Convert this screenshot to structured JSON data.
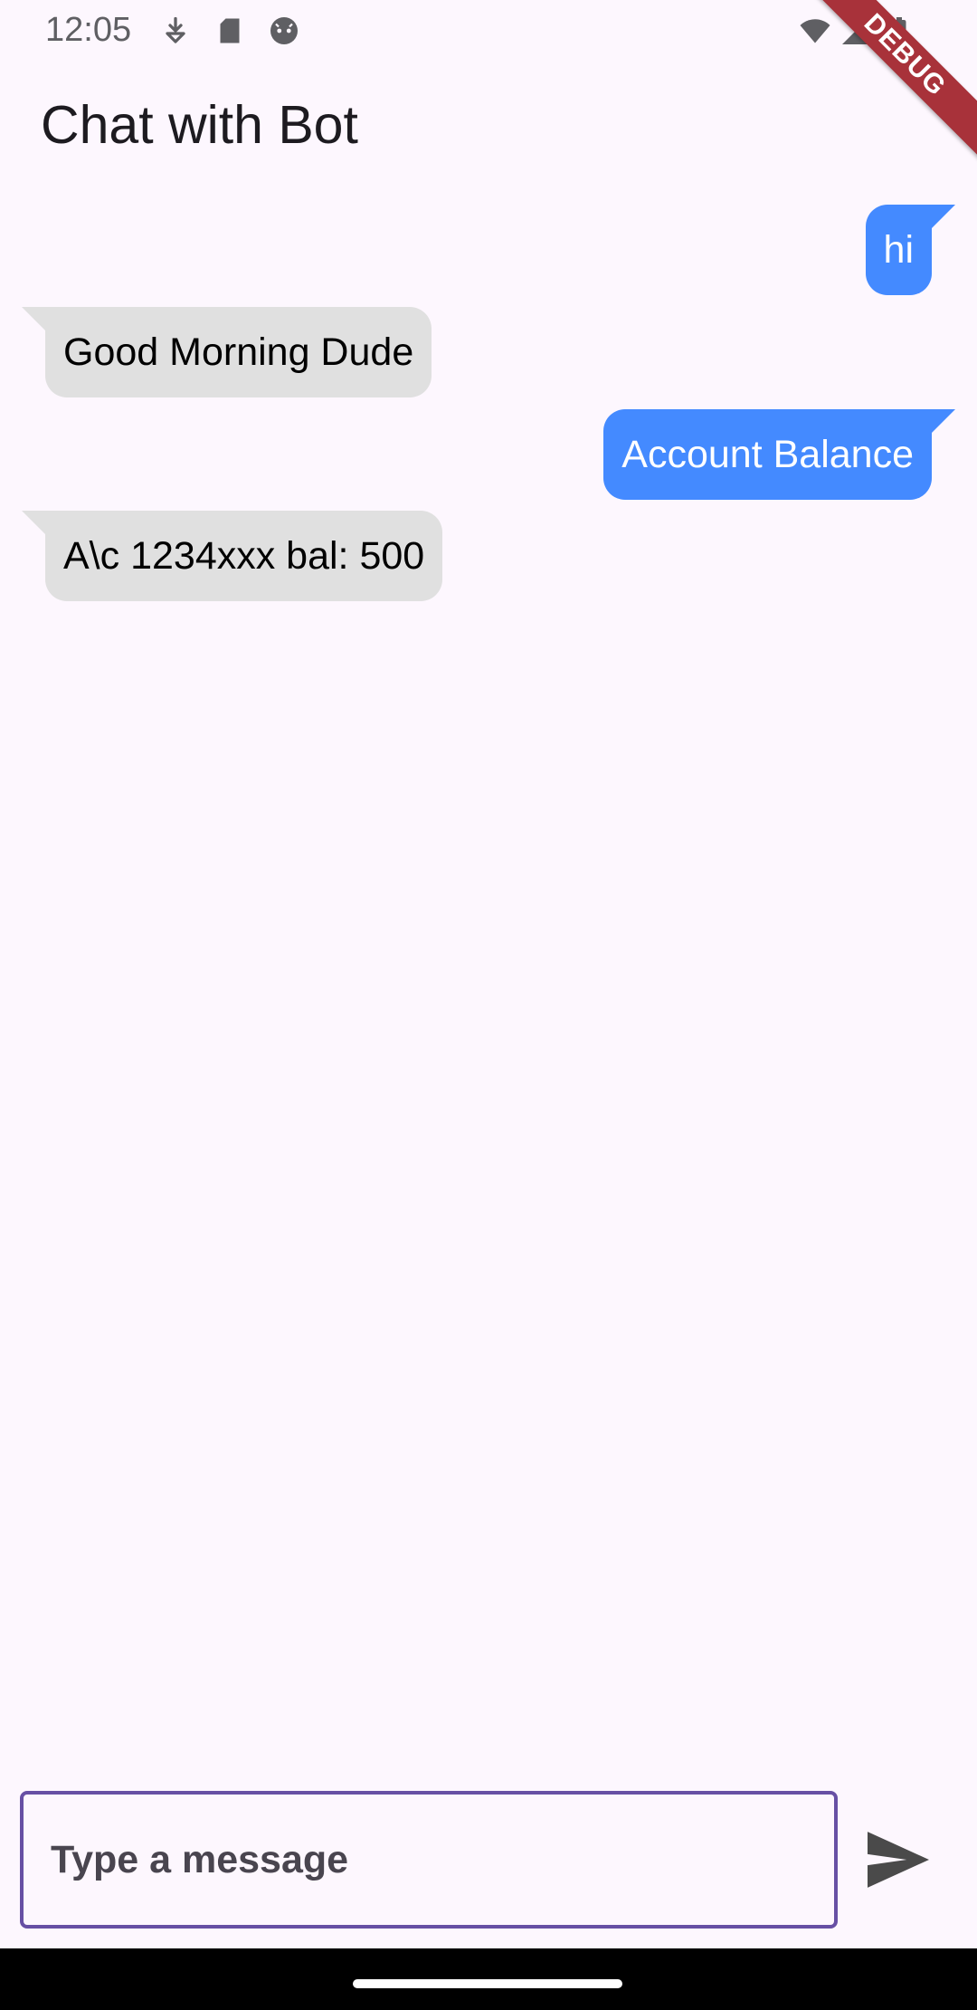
{
  "status_bar": {
    "time": "12:05",
    "left_icons": [
      "download-status-icon",
      "sd-card-icon",
      "android-debug-icon"
    ],
    "right_icons": [
      "wifi-icon",
      "cellular-signal-icon",
      "battery-icon"
    ]
  },
  "debug_banner": "DEBUG",
  "app_bar": {
    "title": "Chat with Bot"
  },
  "messages": [
    {
      "sender": "user",
      "text": "hi"
    },
    {
      "sender": "bot",
      "text": "Good Morning Dude"
    },
    {
      "sender": "user",
      "text": "Account Balance"
    },
    {
      "sender": "bot",
      "text": "A\\c 1234xxx bal: 500"
    }
  ],
  "composer": {
    "placeholder": "Type a message",
    "value": "",
    "send_icon": "send-icon"
  },
  "colors": {
    "background": "#FDF7FE",
    "user_bubble": "#448AFF",
    "bot_bubble": "#E0E0E0",
    "input_border": "#6750A4",
    "debug_ribbon": "#A8323A"
  }
}
